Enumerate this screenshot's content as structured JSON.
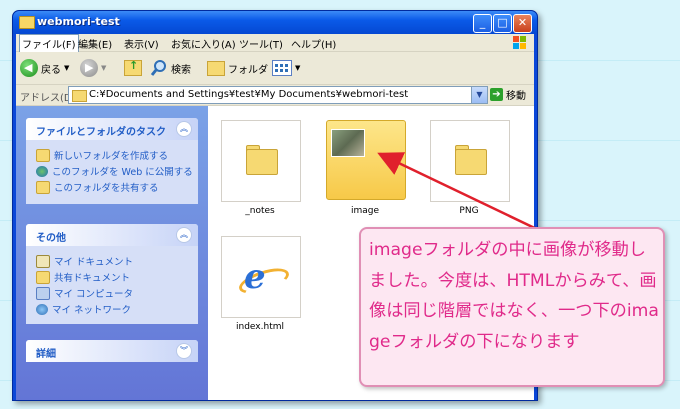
{
  "window": {
    "title": "webmori-test"
  },
  "menu": [
    "ファイル(F)",
    "編集(E)",
    "表示(V)",
    "お気に入り(A)",
    "ツール(T)",
    "ヘルプ(H)"
  ],
  "toolbar": {
    "back_label": "戻る",
    "search_label": "検索",
    "folder_label": "フォルダ"
  },
  "address": {
    "label": "アドレス(D)",
    "path": "C:¥Documents and Settings¥test¥My Documents¥webmori-test",
    "go_label": "移動"
  },
  "tasks": {
    "title": "ファイルとフォルダのタスク",
    "items": [
      "新しいフォルダを作成する",
      "このフォルダを Web に公開する",
      "このフォルダを共有する"
    ]
  },
  "other": {
    "title": "その他",
    "items": [
      "マイ ドキュメント",
      "共有ドキュメント",
      "マイ コンピュータ",
      "マイ ネットワーク"
    ]
  },
  "details": {
    "title": "詳細"
  },
  "files": [
    {
      "name": "_notes"
    },
    {
      "name": "image"
    },
    {
      "name": "PNG"
    },
    {
      "name": "index.html"
    }
  ],
  "callout": {
    "text": "imageフォルダの中に画像が移動しました。今度は、HTMLからみて、画像は同じ階層ではなく、一つ下のimageフォルダの下になります"
  },
  "colors": {
    "callout_text": "#e02a8a",
    "arrow": "#e0202c",
    "titlebar": "#0a5ae8"
  }
}
